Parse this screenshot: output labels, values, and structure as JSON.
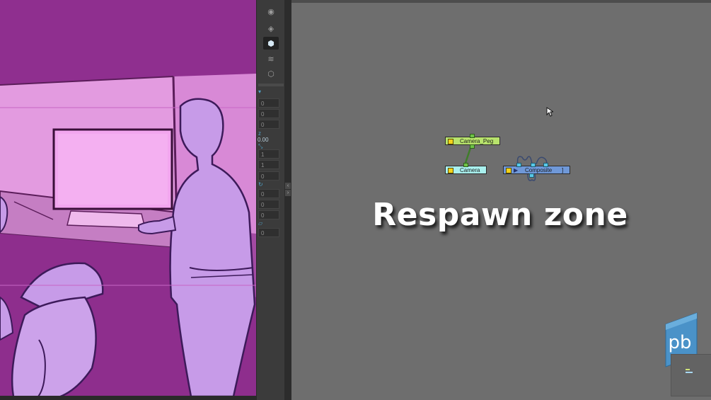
{
  "overlay": {
    "title": "Respawn zone"
  },
  "toolbar": {
    "tools": [
      {
        "icon": "camera-view-icon",
        "glyph": "◉"
      },
      {
        "icon": "top-view-icon",
        "glyph": "◈"
      },
      {
        "icon": "3d-cube-icon",
        "glyph": "⬢"
      },
      {
        "icon": "layer-stack-icon",
        "glyph": "≋"
      },
      {
        "icon": "side-view-icon",
        "glyph": "⬡"
      }
    ]
  },
  "fields": {
    "position": [
      "0",
      "0",
      "0"
    ],
    "z_value": "0.00",
    "scale": [
      "1",
      "1",
      "0"
    ],
    "rotation": [
      "0",
      "0",
      "0"
    ],
    "skew": [
      "0"
    ]
  },
  "nodes": {
    "camera_peg": {
      "label": "Camera_Peg",
      "color": "#b8e36c"
    },
    "camera": {
      "label": "Camera",
      "color": "#a9f0ee"
    },
    "composite": {
      "label": "Composite",
      "color": "#6f98d8",
      "suffix": "]"
    }
  },
  "colors": {
    "viewport_bg": "#a13fa0",
    "nodeview_bg": "#6e6e6e",
    "accent_cyan": "#4fa3c9"
  },
  "logo": {
    "text": "pb"
  }
}
